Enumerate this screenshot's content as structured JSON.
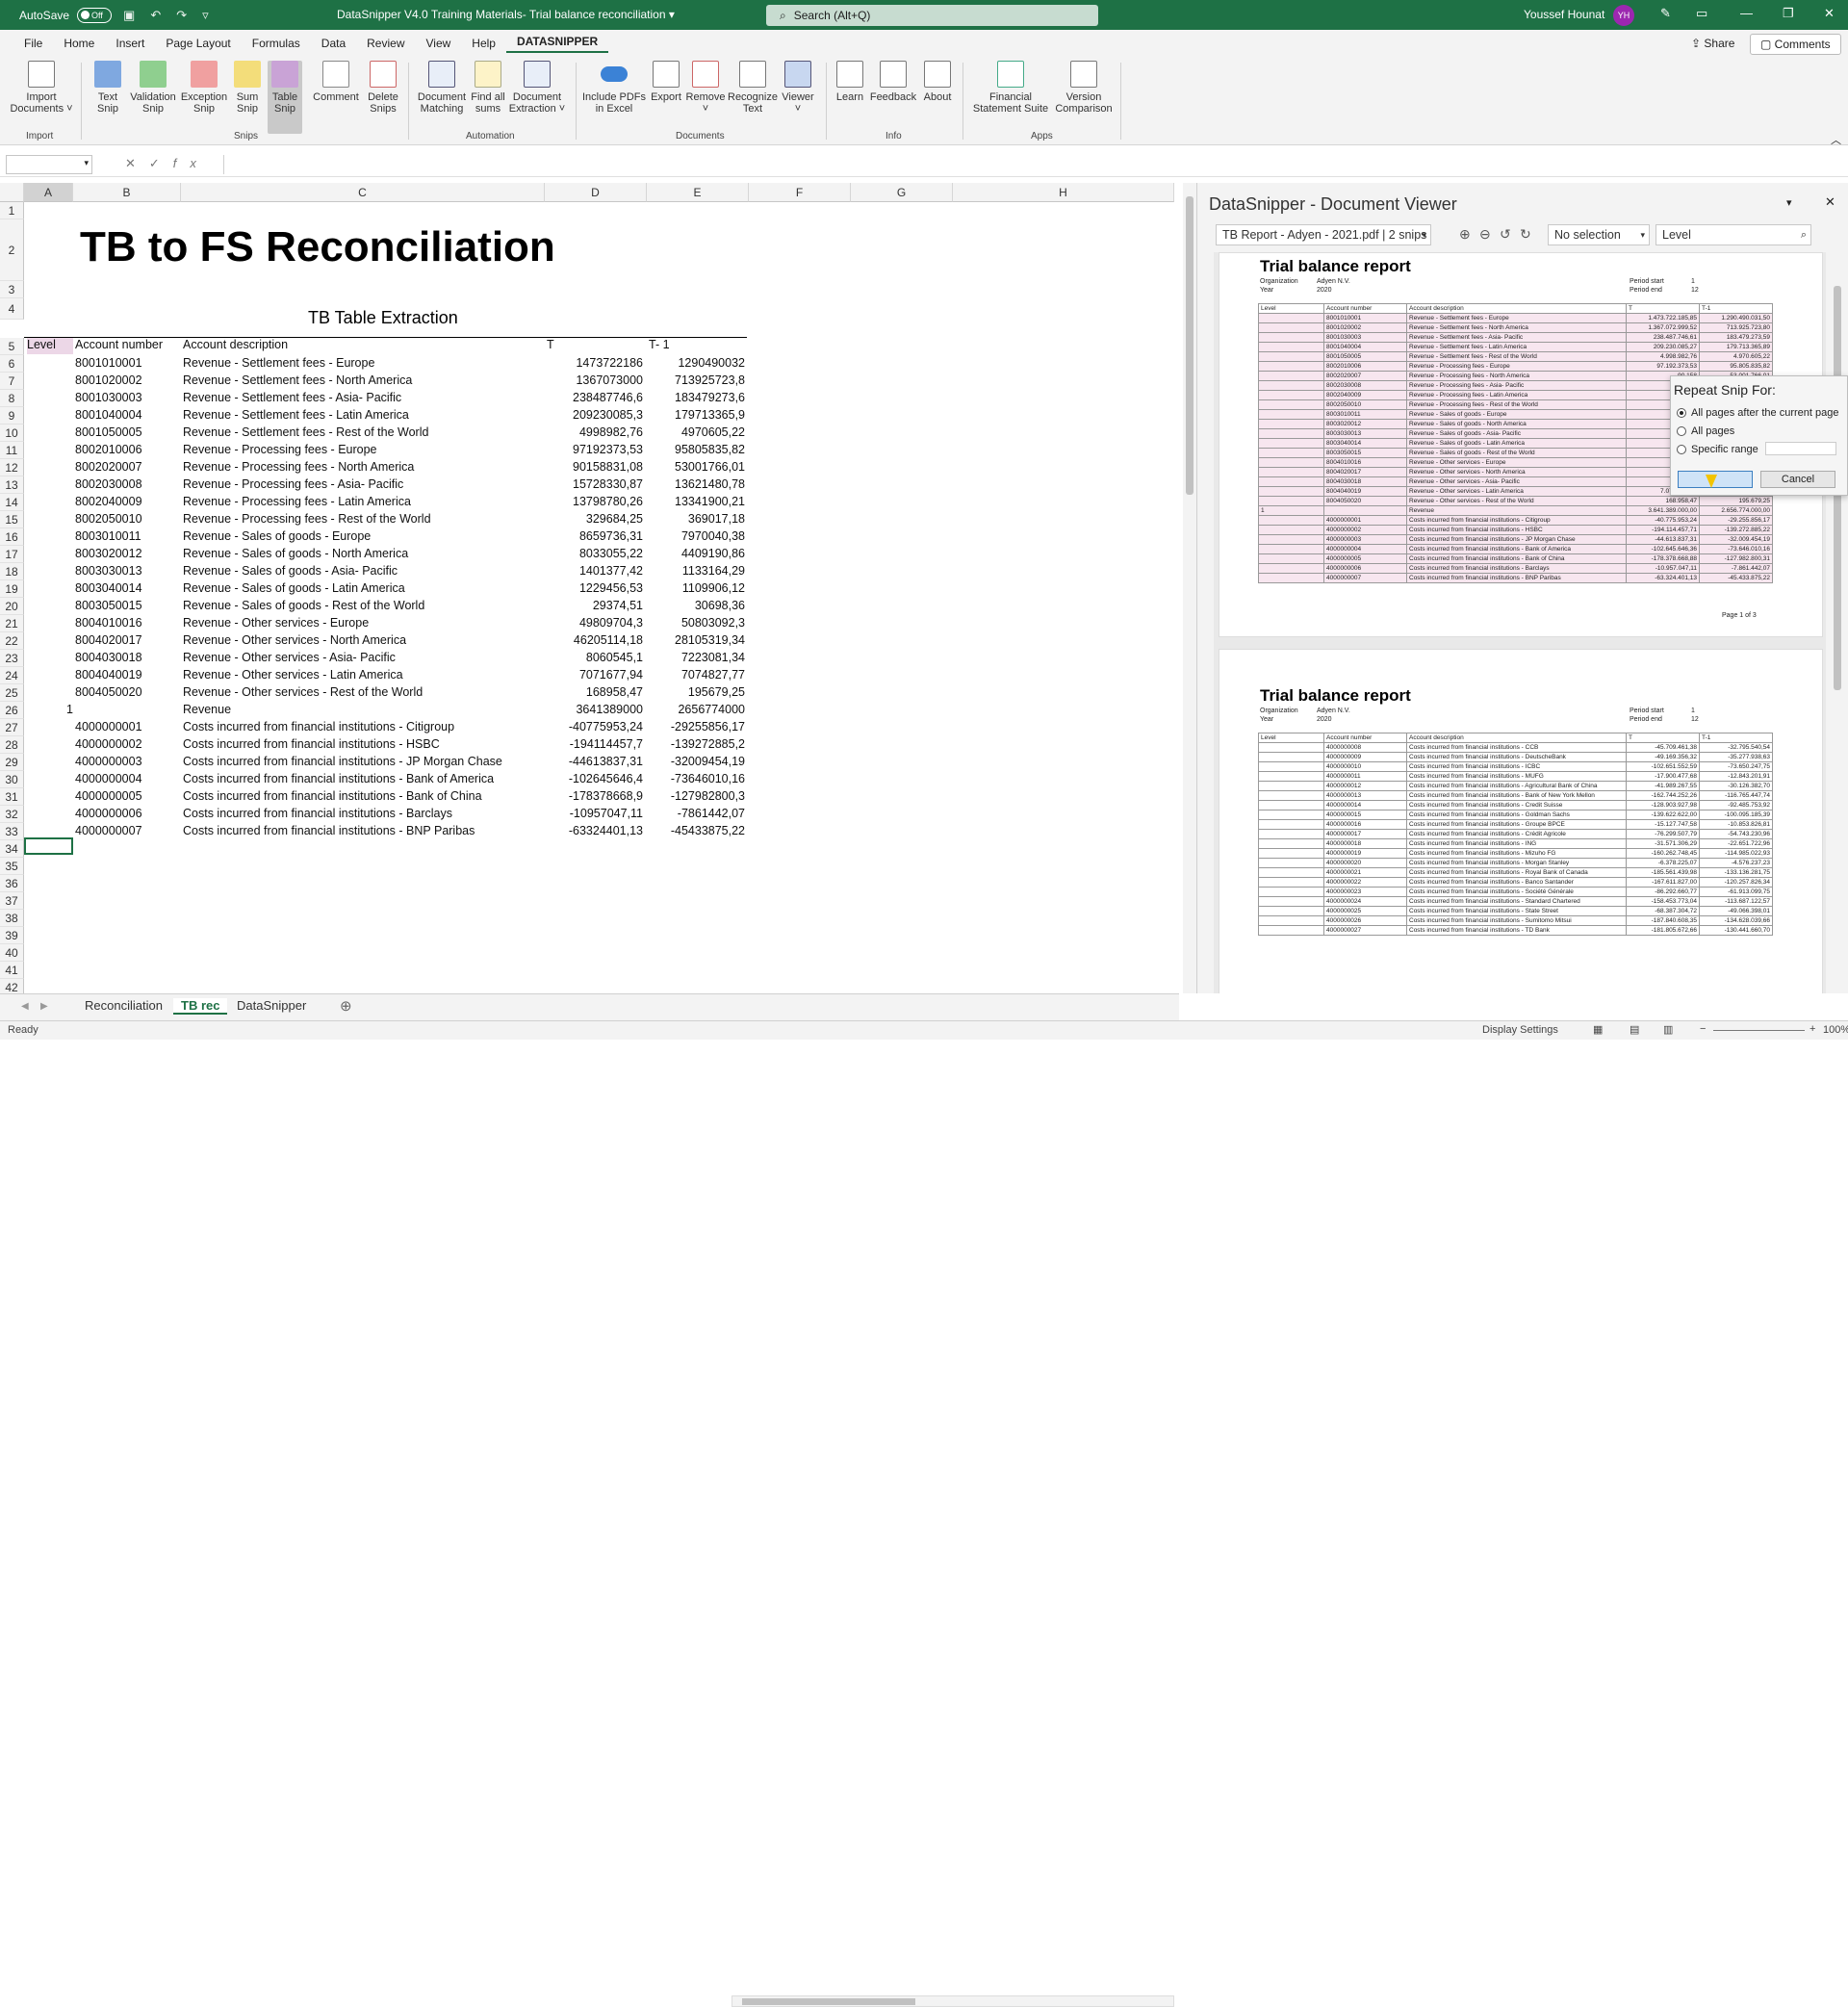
{
  "titlebar": {
    "autosave_label": "AutoSave",
    "autosave_state": "Off",
    "doc_title": "DataSnipper V4.0 Training Materials- Trial balance reconciliation",
    "search_placeholder": "Search (Alt+Q)",
    "user_name": "Youssef Hounat",
    "user_initials": "YH"
  },
  "menu": {
    "items": [
      "File",
      "Home",
      "Insert",
      "Page Layout",
      "Formulas",
      "Data",
      "Review",
      "View",
      "Help",
      "DATASNIPPER"
    ],
    "share": "Share",
    "comments": "Comments"
  },
  "ribbon": {
    "buttons": [
      {
        "label1": "Import",
        "label2": "Documents ˅"
      },
      {
        "label1": "Text",
        "label2": "Snip"
      },
      {
        "label1": "Validation",
        "label2": "Snip"
      },
      {
        "label1": "Exception",
        "label2": "Snip"
      },
      {
        "label1": "Sum",
        "label2": "Snip"
      },
      {
        "label1": "Table",
        "label2": "Snip"
      },
      {
        "label1": "Comment",
        "label2": ""
      },
      {
        "label1": "Delete",
        "label2": "Snips"
      },
      {
        "label1": "Document",
        "label2": "Matching"
      },
      {
        "label1": "Find all",
        "label2": "sums"
      },
      {
        "label1": "Document",
        "label2": "Extraction ˅"
      },
      {
        "label1": "Include PDFs",
        "label2": "in Excel"
      },
      {
        "label1": "Export",
        "label2": ""
      },
      {
        "label1": "Remove",
        "label2": "˅"
      },
      {
        "label1": "Recognize",
        "label2": "Text"
      },
      {
        "label1": "Viewer",
        "label2": "˅"
      },
      {
        "label1": "Learn",
        "label2": ""
      },
      {
        "label1": "Feedback",
        "label2": ""
      },
      {
        "label1": "About",
        "label2": ""
      },
      {
        "label1": "Financial",
        "label2": "Statement Suite"
      },
      {
        "label1": "Version",
        "label2": "Comparison"
      }
    ],
    "groups": [
      "Import",
      "Snips",
      "Automation",
      "Documents",
      "Info",
      "Apps"
    ]
  },
  "grid": {
    "columns": [
      "A",
      "B",
      "C",
      "D",
      "E",
      "F",
      "G",
      "H"
    ],
    "rows": [
      "1",
      "2",
      "3",
      "4",
      "5",
      "6",
      "7",
      "8",
      "9",
      "10",
      "11",
      "12",
      "13",
      "14",
      "15",
      "16",
      "17",
      "18",
      "19",
      "20",
      "21",
      "22",
      "23",
      "24",
      "25",
      "26",
      "27",
      "28",
      "29",
      "30",
      "31",
      "32",
      "33",
      "34",
      "35",
      "36",
      "37",
      "38",
      "39",
      "40",
      "41",
      "42"
    ],
    "sheet_title": "TB to FS Reconciliation",
    "table_title": "TB Table Extraction",
    "headers": {
      "level": "Level",
      "account": "Account number",
      "desc": "Account description",
      "t": "T",
      "t1": "T- 1"
    },
    "data": [
      [
        "",
        "8001010001",
        "Revenue - Settlement fees - Europe",
        "1473722186",
        "1290490032"
      ],
      [
        "",
        "8001020002",
        "Revenue - Settlement fees - North America",
        "1367073000",
        "713925723,8"
      ],
      [
        "",
        "8001030003",
        "Revenue - Settlement fees - Asia- Pacific",
        "238487746,6",
        "183479273,6"
      ],
      [
        "",
        "8001040004",
        "Revenue - Settlement fees - Latin America",
        "209230085,3",
        "179713365,9"
      ],
      [
        "",
        "8001050005",
        "Revenue - Settlement fees - Rest of the World",
        "4998982,76",
        "4970605,22"
      ],
      [
        "",
        "8002010006",
        "Revenue - Processing fees - Europe",
        "97192373,53",
        "95805835,82"
      ],
      [
        "",
        "8002020007",
        "Revenue - Processing fees - North America",
        "90158831,08",
        "53001766,01"
      ],
      [
        "",
        "8002030008",
        "Revenue - Processing fees - Asia- Pacific",
        "15728330,87",
        "13621480,78"
      ],
      [
        "",
        "8002040009",
        "Revenue - Processing fees - Latin America",
        "13798780,26",
        "13341900,21"
      ],
      [
        "",
        "8002050010",
        "Revenue - Processing fees - Rest of the World",
        "329684,25",
        "369017,18"
      ],
      [
        "",
        "8003010011",
        "Revenue - Sales of goods - Europe",
        "8659736,31",
        "7970040,38"
      ],
      [
        "",
        "8003020012",
        "Revenue - Sales of goods - North America",
        "8033055,22",
        "4409190,86"
      ],
      [
        "",
        "8003030013",
        "Revenue - Sales of goods - Asia- Pacific",
        "1401377,42",
        "1133164,29"
      ],
      [
        "",
        "8003040014",
        "Revenue - Sales of goods - Latin America",
        "1229456,53",
        "1109906,12"
      ],
      [
        "",
        "8003050015",
        "Revenue - Sales of goods - Rest of the World",
        "29374,51",
        "30698,36"
      ],
      [
        "",
        "8004010016",
        "Revenue - Other services - Europe",
        "49809704,3",
        "50803092,3"
      ],
      [
        "",
        "8004020017",
        "Revenue - Other services - North America",
        "46205114,18",
        "28105319,34"
      ],
      [
        "",
        "8004030018",
        "Revenue - Other services - Asia- Pacific",
        "8060545,1",
        "7223081,34"
      ],
      [
        "",
        "8004040019",
        "Revenue - Other services - Latin America",
        "7071677,94",
        "7074827,77"
      ],
      [
        "",
        "8004050020",
        "Revenue - Other services - Rest of the World",
        "168958,47",
        "195679,25"
      ],
      [
        "1",
        "",
        "Revenue",
        "3641389000",
        "2656774000"
      ],
      [
        "",
        "4000000001",
        "Costs incurred from financial institutions - Citigroup",
        "-40775953,24",
        "-29255856,17"
      ],
      [
        "",
        "4000000002",
        "Costs incurred from financial institutions - HSBC",
        "-194114457,7",
        "-139272885,2"
      ],
      [
        "",
        "4000000003",
        "Costs incurred from financial institutions - JP Morgan Chase",
        "-44613837,31",
        "-32009454,19"
      ],
      [
        "",
        "4000000004",
        "Costs incurred from financial institutions - Bank of America",
        "-102645646,4",
        "-73646010,16"
      ],
      [
        "",
        "4000000005",
        "Costs incurred from financial institutions - Bank of China",
        "-178378668,9",
        "-127982800,3"
      ],
      [
        "",
        "4000000006",
        "Costs incurred from financial institutions - Barclays",
        "-10957047,11",
        "-7861442,07"
      ],
      [
        "",
        "4000000007",
        "Costs incurred from financial institutions - BNP Paribas",
        "-63324401,13",
        "-45433875,22"
      ]
    ]
  },
  "sheet_tabs": [
    "Reconciliation",
    "TB rec",
    "DataSnipper"
  ],
  "status": {
    "ready": "Ready",
    "display_settings": "Display Settings",
    "zoom": "100%"
  },
  "viewer": {
    "title": "DataSnipper - Document Viewer",
    "doc_select": "TB Report - Adyen - 2021.pdf | 2 snips",
    "selection": "No selection",
    "level": "Level",
    "page1": {
      "title": "Trial balance report",
      "org_label": "Organization",
      "org_value": "Adyen N.V.",
      "year_label": "Year",
      "year_value": "2020",
      "pstart_label": "Period start",
      "pstart_value": "1",
      "pend_label": "Period end",
      "pend_value": "12",
      "footer": "Page 1 of 3",
      "cols": [
        "Level",
        "Account number",
        "Account description",
        "T",
        "T-1"
      ],
      "rows": [
        [
          "",
          "8001010001",
          "Revenue - Settlement fees - Europe",
          "1.473.722.185,85",
          "1.290.490.031,50"
        ],
        [
          "",
          "8001020002",
          "Revenue - Settlement fees - North America",
          "1.367.072.999,52",
          "713.925.723,80"
        ],
        [
          "",
          "8001030003",
          "Revenue - Settlement fees - Asia- Pacific",
          "238.487.746,61",
          "183.479.273,59"
        ],
        [
          "",
          "8001040004",
          "Revenue - Settlement fees - Latin America",
          "209.230.085,27",
          "179.713.365,89"
        ],
        [
          "",
          "8001050005",
          "Revenue - Settlement fees - Rest of the World",
          "4.998.982,76",
          "4.970.605,22"
        ],
        [
          "",
          "8002010006",
          "Revenue - Processing fees - Europe",
          "97.192.373,53",
          "95.805.835,82"
        ],
        [
          "",
          "8002020007",
          "Revenue - Processing fees - North America",
          "90.158",
          "53.001.766,01"
        ],
        [
          "",
          "8002030008",
          "Revenue - Processing fees - Asia- Pacific",
          "15.728",
          "13.621.480,78"
        ],
        [
          "",
          "8002040009",
          "Revenue - Processing fees - Latin America",
          "13.798",
          "13.341.900,21"
        ],
        [
          "",
          "8002050010",
          "Revenue - Processing fees - Rest of the World",
          "329",
          "369.017,18"
        ],
        [
          "",
          "8003010011",
          "Revenue - Sales of goods - Europe",
          "8.659",
          "7.970.040,38"
        ],
        [
          "",
          "8003020012",
          "Revenue - Sales of goods - North America",
          "8.033",
          "4.409.190,86"
        ],
        [
          "",
          "8003030013",
          "Revenue - Sales of goods - Asia- Pacific",
          "1.401",
          "1.133.164,29"
        ],
        [
          "",
          "8003040014",
          "Revenue - Sales of goods - Latin America",
          "1.229",
          "1.109.906,12"
        ],
        [
          "",
          "8003050015",
          "Revenue - Sales of goods - Rest of the World",
          "29",
          "30.698,36"
        ],
        [
          "",
          "8004010016",
          "Revenue - Other services - Europe",
          "49.809",
          "50.803.092,30"
        ],
        [
          "",
          "8004020017",
          "Revenue - Other services - North America",
          "46.205",
          "28.105.319,34"
        ],
        [
          "",
          "8004030018",
          "Revenue - Other services - Asia- Pacific",
          "8.060",
          "7.223.081,34"
        ],
        [
          "",
          "8004040019",
          "Revenue - Other services - Latin America",
          "7.071.677,94",
          "7.074.827,77"
        ],
        [
          "",
          "8004050020",
          "Revenue - Other services - Rest of the World",
          "168.958,47",
          "195.679,25"
        ],
        [
          "1",
          "",
          "Revenue",
          "3.641.389.000,00",
          "2.656.774.000,00"
        ],
        [
          "",
          "4000000001",
          "Costs incurred from financial institutions - Citigroup",
          "-40.775.953,24",
          "-29.255.856,17"
        ],
        [
          "",
          "4000000002",
          "Costs incurred from financial institutions - HSBC",
          "-194.114.457,71",
          "-139.272.885,22"
        ],
        [
          "",
          "4000000003",
          "Costs incurred from financial institutions - JP Morgan Chase",
          "-44.613.837,31",
          "-32.009.454,19"
        ],
        [
          "",
          "4000000004",
          "Costs incurred from financial institutions - Bank of America",
          "-102.645.646,36",
          "-73.646.010,16"
        ],
        [
          "",
          "4000000005",
          "Costs incurred from financial institutions - Bank of China",
          "-178.378.668,88",
          "-127.982.800,31"
        ],
        [
          "",
          "4000000006",
          "Costs incurred from financial institutions - Barclays",
          "-10.957.047,11",
          "-7.861.442,07"
        ],
        [
          "",
          "4000000007",
          "Costs incurred from financial institutions - BNP Paribas",
          "-63.324.401,13",
          "-45.433.875,22"
        ]
      ]
    },
    "page2": {
      "title": "Trial balance report",
      "rows": [
        [
          "",
          "4000000008",
          "Costs incurred from financial institutions - CCB",
          "-45.709.461,38",
          "-32.795.540,54"
        ],
        [
          "",
          "4000000009",
          "Costs incurred from financial institutions - DeutscheBank",
          "-49.169.356,32",
          "-35.277.938,63"
        ],
        [
          "",
          "4000000010",
          "Costs incurred from financial institutions - ICBC",
          "-102.651.552,59",
          "-73.650.247,75"
        ],
        [
          "",
          "4000000011",
          "Costs incurred from financial institutions - MUFG",
          "-17.900.477,68",
          "-12.843.201,91"
        ],
        [
          "",
          "4000000012",
          "Costs incurred from financial institutions - Agricultural Bank of China",
          "-41.989.267,55",
          "-30.126.382,70"
        ],
        [
          "",
          "4000000013",
          "Costs incurred from financial institutions - Bank of New York Mellon",
          "-162.744.252,26",
          "-116.765.447,74"
        ],
        [
          "",
          "4000000014",
          "Costs incurred from financial institutions - Credit Suisse",
          "-128.903.927,98",
          "-92.485.753,92"
        ],
        [
          "",
          "4000000015",
          "Costs incurred from financial institutions - Goldman Sachs",
          "-139.622.622,00",
          "-100.095.185,39"
        ],
        [
          "",
          "4000000016",
          "Costs incurred from financial institutions - Groupe BPCE",
          "-15.127.747,58",
          "-10.853.826,81"
        ],
        [
          "",
          "4000000017",
          "Costs incurred from financial institutions - Crédit Agricole",
          "-76.299.507,79",
          "-54.743.230,96"
        ],
        [
          "",
          "4000000018",
          "Costs incurred from financial institutions - ING",
          "-31.571.306,29",
          "-22.651.722,96"
        ],
        [
          "",
          "4000000019",
          "Costs incurred from financial institutions - Mizuho FG",
          "-160.262.748,45",
          "-114.985.022,93"
        ],
        [
          "",
          "4000000020",
          "Costs incurred from financial institutions - Morgan Stanley",
          "-6.378.225,07",
          "-4.576.237,23"
        ],
        [
          "",
          "4000000021",
          "Costs incurred from financial institutions - Royal Bank of Canada",
          "-185.561.439,98",
          "-133.136.281,75"
        ],
        [
          "",
          "4000000022",
          "Costs incurred from financial institutions - Banco Santander",
          "-167.611.827,00",
          "-120.257.826,34"
        ],
        [
          "",
          "4000000023",
          "Costs incurred from financial institutions - Société Générale",
          "-86.292.660,77",
          "-61.913.099,75"
        ],
        [
          "",
          "4000000024",
          "Costs incurred from financial institutions - Standard Chartered",
          "-158.453.773,04",
          "-113.687.122,57"
        ],
        [
          "",
          "4000000025",
          "Costs incurred from financial institutions - State Street",
          "-68.387.304,72",
          "-49.066.398,01"
        ],
        [
          "",
          "4000000026",
          "Costs incurred from financial institutions - Sumitomo Mitsui",
          "-187.840.608,35",
          "-134.628.039,66"
        ],
        [
          "",
          "4000000027",
          "Costs incurred from financial institutions - TD Bank",
          "-181.805.672,66",
          "-130.441.660,70"
        ]
      ]
    }
  },
  "popup": {
    "title": "Repeat Snip For:",
    "opt1": "All pages after the current page",
    "opt2": "All pages",
    "opt3": "Specific range",
    "cancel": "Cancel"
  }
}
